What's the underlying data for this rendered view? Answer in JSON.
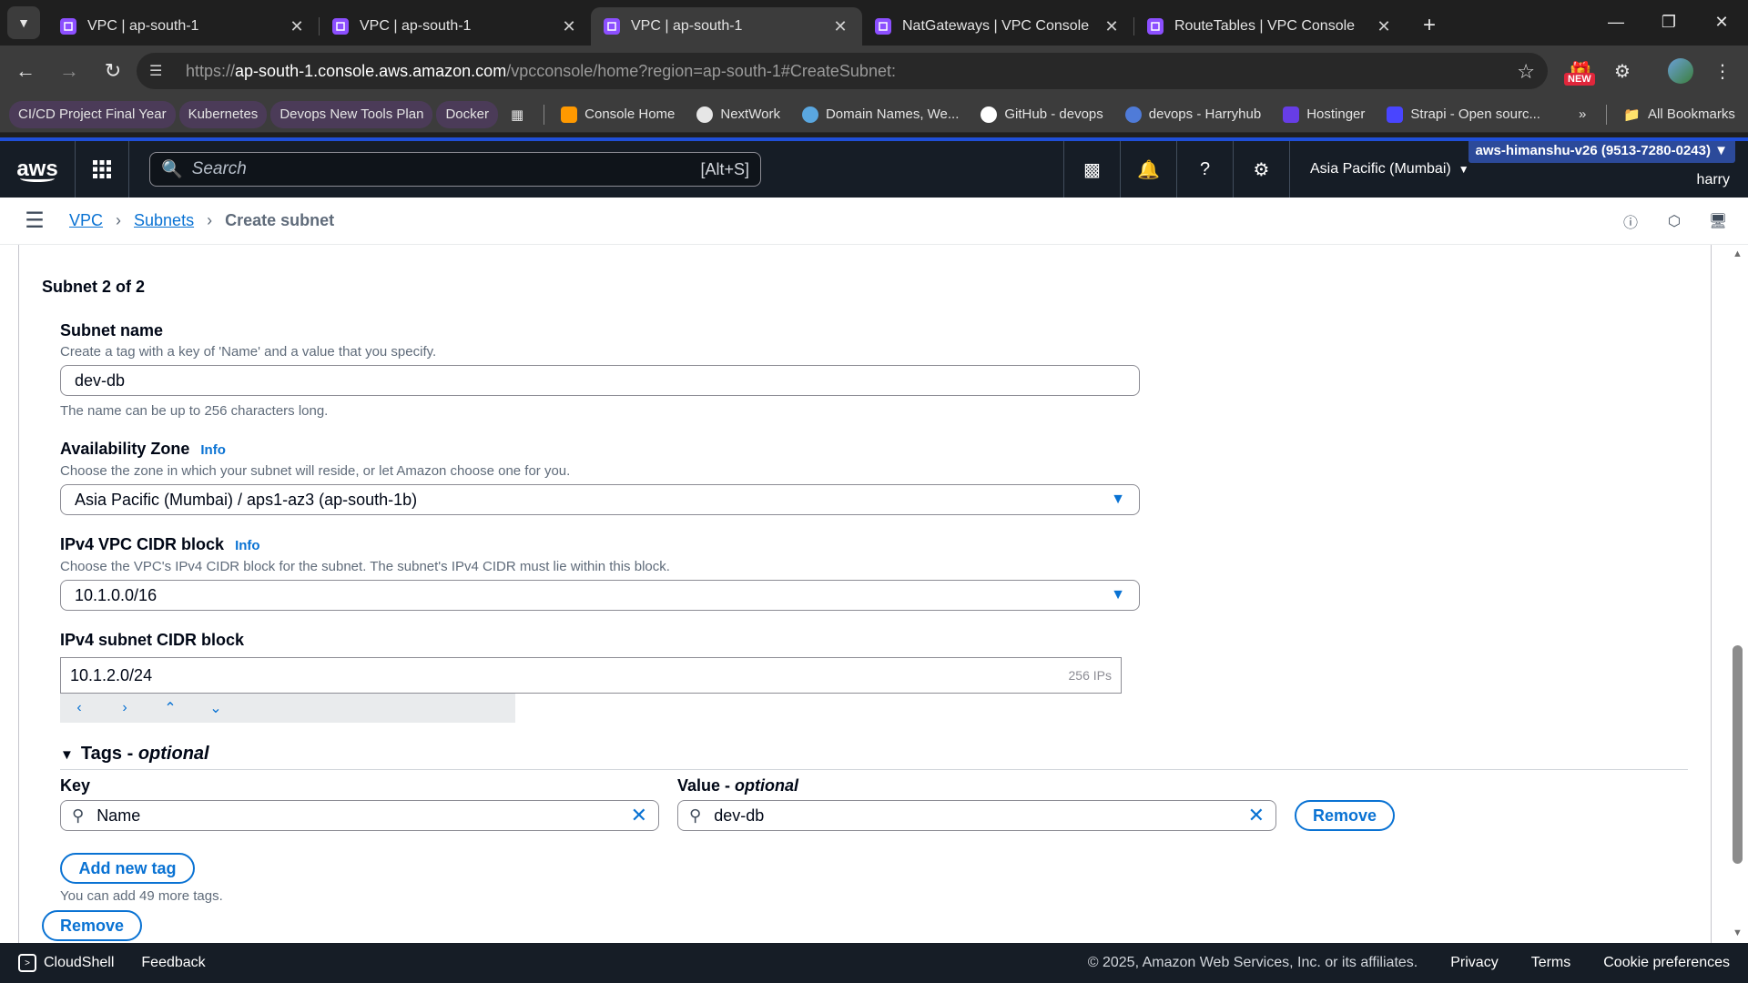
{
  "browser": {
    "tabs": [
      {
        "label": "VPC | ap-south-1",
        "active": false
      },
      {
        "label": "VPC | ap-south-1",
        "active": false
      },
      {
        "label": "VPC | ap-south-1",
        "active": true
      },
      {
        "label": "NatGateways | VPC Console",
        "active": false
      },
      {
        "label": "RouteTables | VPC Console",
        "active": false
      }
    ],
    "url_prefix": "https://",
    "url_host": "ap-south-1.console.aws.amazon.com",
    "url_path": "/vpcconsole/home?region=ap-south-1#CreateSubnet:",
    "new_badge": "NEW",
    "bookmarks": [
      {
        "label": "CI/CD Project Final Year",
        "pill": true,
        "color": ""
      },
      {
        "label": "Kubernetes",
        "pill": true,
        "color": ""
      },
      {
        "label": "Devops New Tools Plan",
        "pill": true,
        "color": ""
      },
      {
        "label": "Docker",
        "pill": true,
        "color": ""
      },
      {
        "label": "Console Home",
        "pill": false,
        "color": "#ff9900"
      },
      {
        "label": "NextWork",
        "pill": false,
        "color": "#e6e6e6"
      },
      {
        "label": "Domain Names, We...",
        "pill": false,
        "color": "#5aa7e0"
      },
      {
        "label": "GitHub - devops",
        "pill": false,
        "color": "#ffffff"
      },
      {
        "label": "devops - Harryhub",
        "pill": false,
        "color": "#4f7bd8"
      },
      {
        "label": "Hostinger",
        "pill": false,
        "color": "#673de6"
      },
      {
        "label": "Strapi - Open sourc...",
        "pill": false,
        "color": "#4945ff"
      }
    ],
    "all_bookmarks": "All Bookmarks"
  },
  "aws": {
    "logo": "aws",
    "search_placeholder": "Search",
    "search_shortcut": "[Alt+S]",
    "region": "Asia Pacific (Mumbai)",
    "account": "aws-himanshu-v26 (9513-7280-0243)",
    "user": "harry"
  },
  "breadcrumb": {
    "vpc": "VPC",
    "subnets": "Subnets",
    "current": "Create subnet"
  },
  "form": {
    "section_title": "Subnet 2 of 2",
    "subnet_name": {
      "label": "Subnet name",
      "desc": "Create a tag with a key of 'Name' and a value that you specify.",
      "value": "dev-db",
      "hint": "The name can be up to 256 characters long."
    },
    "az": {
      "label": "Availability Zone",
      "info": "Info",
      "desc": "Choose the zone in which your subnet will reside, or let Amazon choose one for you.",
      "value": "Asia Pacific (Mumbai) / aps1-az3 (ap-south-1b)"
    },
    "vpc_cidr": {
      "label": "IPv4 VPC CIDR block",
      "info": "Info",
      "desc": "Choose the VPC's IPv4 CIDR block for the subnet. The subnet's IPv4 CIDR must lie within this block.",
      "value": "10.1.0.0/16"
    },
    "subnet_cidr": {
      "label": "IPv4 subnet CIDR block",
      "value": "10.1.2.0/24",
      "ips": "256 IPs"
    },
    "tags": {
      "title": "Tags - ",
      "title_optional": "optional",
      "key_label": "Key",
      "value_label": "Value - ",
      "value_optional": "optional",
      "key": "Name",
      "value": "dev-db",
      "remove_tag": "Remove",
      "add_tag": "Add new tag",
      "note": "You can add 49 more tags."
    },
    "remove_subnet": "Remove"
  },
  "footer": {
    "cloudshell": "CloudShell",
    "feedback": "Feedback",
    "copyright": "© 2025, Amazon Web Services, Inc. or its affiliates.",
    "privacy": "Privacy",
    "terms": "Terms",
    "cookies": "Cookie preferences"
  }
}
